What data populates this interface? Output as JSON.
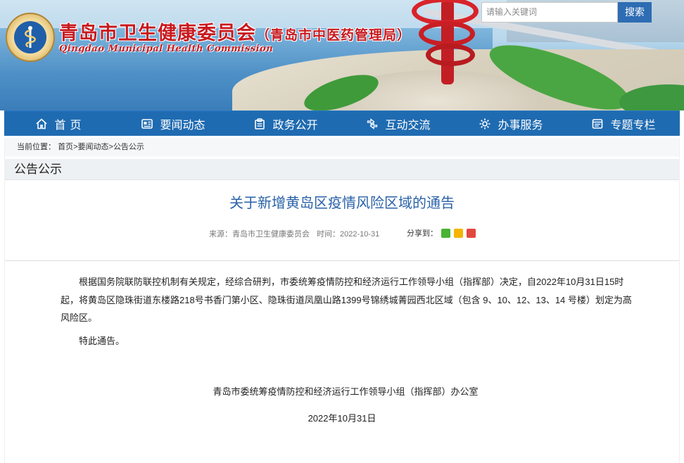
{
  "header": {
    "title": "青岛市卫生健康委员会",
    "title_sub": "（青岛市中医药管理局）",
    "title_en": "Qingdao Municipal Health Commission",
    "logo_icon": "health-emblem-icon",
    "search": {
      "placeholder": "请输入关键词",
      "button_label": "搜索"
    }
  },
  "nav": {
    "items": [
      {
        "label": "首页",
        "icon": "home-icon"
      },
      {
        "label": "要闻动态",
        "icon": "news-icon"
      },
      {
        "label": "政务公开",
        "icon": "govt-icon"
      },
      {
        "label": "互动交流",
        "icon": "interaction-icon"
      },
      {
        "label": "办事服务",
        "icon": "service-icon"
      },
      {
        "label": "专题专栏",
        "icon": "topic-icon"
      }
    ]
  },
  "breadcrumb": {
    "prefix": "当前位置：",
    "items": [
      "首页",
      "要闻动态",
      "公告公示"
    ],
    "separator": ">"
  },
  "section": {
    "title": "公告公示"
  },
  "article": {
    "title": "关于新增黄岛区疫情风险区域的通告",
    "source": "来源：青岛市卫生健康委员会",
    "time": "时间：2022-10-31",
    "share_label": "分享到：",
    "share_icons": [
      "wechat-icon",
      "qzone-icon",
      "weibo-icon"
    ],
    "paragraph": "根据国务院联防联控机制有关规定，经综合研判，市委统筹疫情防控和经济运行工作领导小组（指挥部）决定，自2022年10月31日15时起，将黄岛区隐珠街道东楼路218号书香门第小区、隐珠街道凤凰山路1399号锦绣城菁园西北区域（包含 9、10、12、13、14 号楼）划定为高风险区。",
    "closing": "特此通告。",
    "signer": "青岛市委统筹疫情防控和经济运行工作领导小组（指挥部）办公室",
    "date": "2022年10月31日"
  },
  "colors": {
    "nav_bg": "#1f6bb1",
    "title_red": "#c81a1f",
    "article_title": "#2a62a8",
    "search_button": "#2e6cb3"
  }
}
